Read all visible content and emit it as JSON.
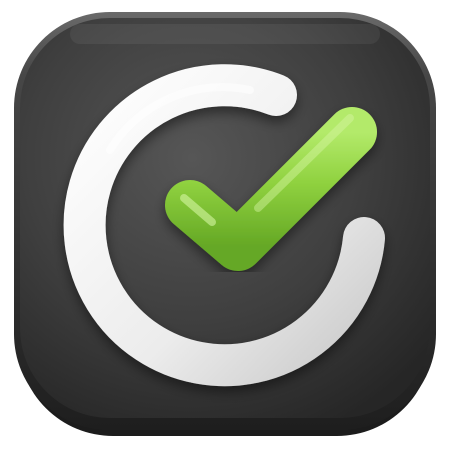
{
  "icon": {
    "name": "checkmark-done-icon",
    "colors": {
      "tile_base": "#3a3a3a",
      "tile_top": "#505050",
      "tile_dark": "#252525",
      "ring": "#f0f0f0",
      "ring_shade": "#bdbdbd",
      "check": "#8ed13f",
      "check_light": "#b6ec6f",
      "check_dark": "#5da21f"
    }
  }
}
